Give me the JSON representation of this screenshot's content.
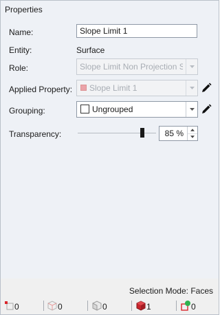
{
  "panel": {
    "title": "Properties"
  },
  "fields": {
    "name": {
      "label": "Name:",
      "value": "Slope Limit 1"
    },
    "entity": {
      "label": "Entity:",
      "value": "Surface"
    },
    "role": {
      "label": "Role:",
      "value": "Slope Limit Non Projection Surface"
    },
    "applied_property": {
      "label": "Applied Property:",
      "value": "Slope Limit 1",
      "swatch_color": "#e76f78"
    },
    "grouping": {
      "label": "Grouping:",
      "value": "Ungrouped"
    },
    "transparency": {
      "label": "Transparency:",
      "value": "85 %",
      "level_percent": 85
    }
  },
  "status": {
    "selection_mode_label": "Selection Mode:",
    "selection_mode_value": "Faces",
    "counters": [
      {
        "icon": "vertex-icon",
        "count": "0"
      },
      {
        "icon": "edge-icon",
        "count": "0"
      },
      {
        "icon": "face-icon",
        "count": "0"
      },
      {
        "icon": "solid-icon",
        "count": "1"
      },
      {
        "icon": "group-icon",
        "count": "0"
      }
    ]
  }
}
